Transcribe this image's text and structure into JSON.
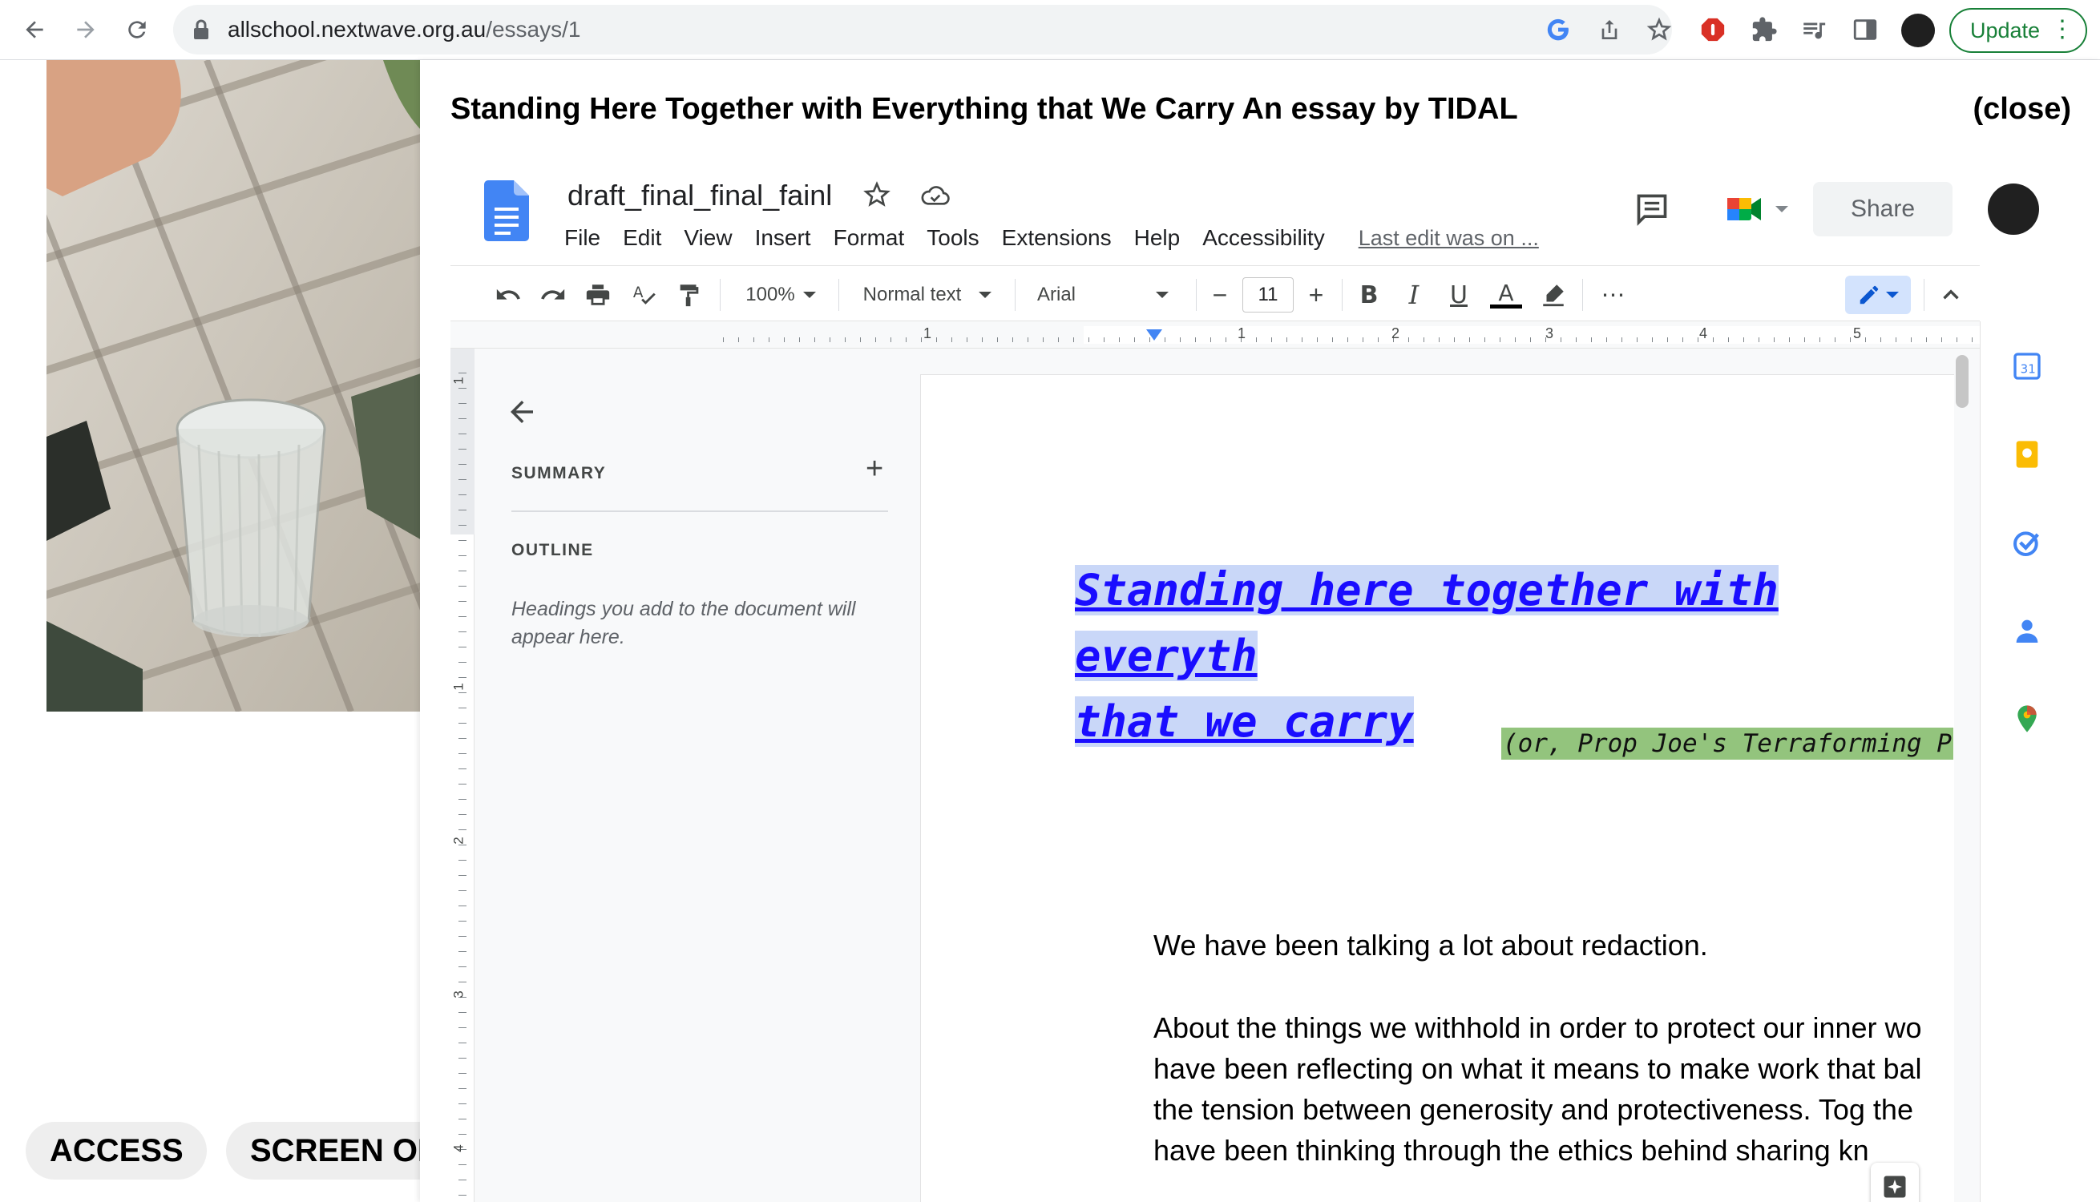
{
  "browser": {
    "url_host": "allschool.nextwave.org.au",
    "url_path": "/essays/1",
    "update_label": "Update"
  },
  "background_page": {
    "pills": [
      "ACCESS",
      "SCREEN ON"
    ]
  },
  "modal": {
    "title": "Standing Here Together with Everything that We Carry  An essay by TIDAL",
    "close_label": "(close)"
  },
  "docs": {
    "doc_name": "draft_final_final_fainl",
    "menu": [
      "File",
      "Edit",
      "View",
      "Insert",
      "Format",
      "Tools",
      "Extensions",
      "Help",
      "Accessibility"
    ],
    "last_edit": "Last edit was on ...",
    "share_label": "Share",
    "toolbar": {
      "zoom": "100%",
      "style": "Normal text",
      "font": "Arial",
      "font_size": "11"
    },
    "ruler_numbers": [
      "1",
      "1",
      "2",
      "3",
      "4",
      "5"
    ],
    "vruler_numbers": [
      "1",
      "1",
      "2",
      "3",
      "4"
    ],
    "outline": {
      "summary_label": "SUMMARY",
      "outline_label": "OUTLINE",
      "hint": "Headings you add to the document will appear here."
    },
    "document": {
      "title_line1": "Standing here together with everyth",
      "title_line2": "that we carry",
      "subtitle": "(or, Prop Joe's Terraforming P",
      "para1": "We have been talking a lot about redaction.",
      "para2": "About the things we withhold in order to protect our inner wo have been reflecting on what it means to make work that bal the tension between generosity and protectiveness. Tog the have been thinking through the ethics behind sharing kn"
    }
  },
  "colors": {
    "link_blue": "#1a0dff",
    "title_highlight": "#c9d7f8",
    "subtitle_highlight": "#93c47d",
    "update_green": "#188038"
  }
}
